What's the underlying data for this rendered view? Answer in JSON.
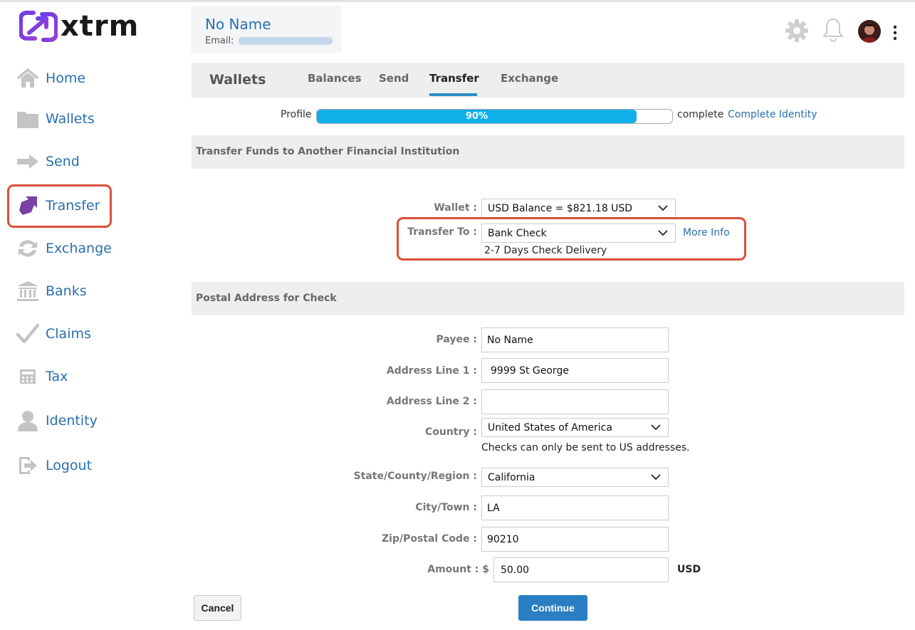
{
  "brand": {
    "name": "xtrm",
    "accent": "#7b3fe0",
    "link_color": "#2a6fb0"
  },
  "sidebar": {
    "items": [
      {
        "label": "Home",
        "icon": "home-icon"
      },
      {
        "label": "Wallets",
        "icon": "folder-icon"
      },
      {
        "label": "Send",
        "icon": "arrow-right-icon"
      },
      {
        "label": "Transfer",
        "icon": "transfer-arrow-icon",
        "active": true
      },
      {
        "label": "Exchange",
        "icon": "exchange-icon"
      },
      {
        "label": "Banks",
        "icon": "bank-icon"
      },
      {
        "label": "Claims",
        "icon": "checkmark-icon"
      },
      {
        "label": "Tax",
        "icon": "calculator-icon"
      },
      {
        "label": "Identity",
        "icon": "person-icon"
      },
      {
        "label": "Logout",
        "icon": "logout-icon"
      }
    ]
  },
  "user": {
    "name": "No Name",
    "email_label": "Email:"
  },
  "header": {
    "icons": [
      "gear-icon",
      "bell-icon",
      "avatar",
      "kebab-menu-icon"
    ]
  },
  "tabs": {
    "title": "Wallets",
    "items": [
      {
        "label": "Balances"
      },
      {
        "label": "Send"
      },
      {
        "label": "Transfer",
        "active": true
      },
      {
        "label": "Exchange"
      }
    ]
  },
  "profile": {
    "label": "Profile",
    "percent": 90,
    "percent_text": "90%",
    "complete_text": "complete",
    "link": "Complete Identity",
    "fill_color": "#0fb0ea"
  },
  "transfer_section": {
    "title": "Transfer Funds to Another Financial Institution",
    "wallet_label": "Wallet :",
    "wallet_value": "USD Balance = $821.18 USD",
    "transfer_to_label": "Transfer To :",
    "transfer_to_value": "Bank Check",
    "more_info": "More Info",
    "delivery_note": "2-7 Days Check Delivery"
  },
  "postal_section": {
    "title": "Postal Address for Check",
    "payee_label": "Payee :",
    "payee_value": "No Name",
    "address1_label": "Address Line 1 :",
    "address1_value": "9999 St George",
    "address2_label": "Address Line 2 :",
    "address2_value": "",
    "country_label": "Country :",
    "country_value": "United States of America",
    "country_note": "Checks can only be sent to US addresses.",
    "state_label": "State/County/Region :",
    "state_value": "California",
    "city_label": "City/Town :",
    "city_value": "LA",
    "zip_label": "Zip/Postal Code :",
    "zip_value": "90210",
    "amount_label": "Amount : $",
    "amount_value": "50.00",
    "amount_currency": "USD"
  },
  "actions": {
    "cancel": "Cancel",
    "continue": "Continue"
  }
}
